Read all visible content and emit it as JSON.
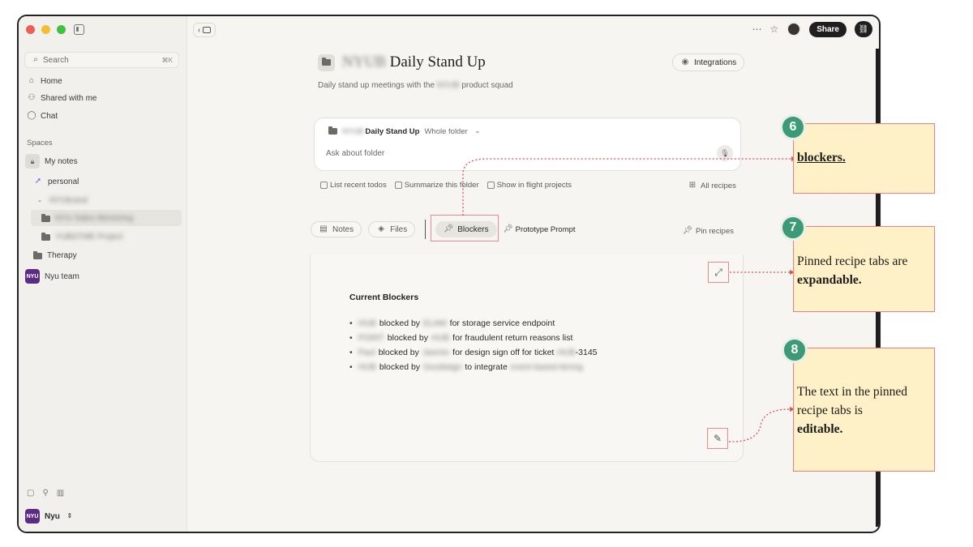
{
  "sidebar": {
    "search_placeholder": "Search",
    "search_shortcut": "⌘K",
    "nav": [
      {
        "label": "Home",
        "icon": "home-icon"
      },
      {
        "label": "Shared with me",
        "icon": "people-icon"
      },
      {
        "label": "Chat",
        "icon": "chat-icon"
      }
    ],
    "spaces_label": "Spaces",
    "my_notes": "My notes",
    "personal": "personal",
    "blurred_1": "NYUbrand",
    "blurred_2": "NYU Sales Mentoring",
    "blurred_3": "YUBOTME Project",
    "therapy": "Therapy",
    "team": "Nyu team",
    "team_badge": "NYU",
    "user": "Nyu",
    "user_badge": "NYU"
  },
  "header": {
    "back_label": "‹",
    "share_label": "Share",
    "title_prefix": "NYUB",
    "title": "Daily Stand Up",
    "integrations_label": "Integrations",
    "subtitle_pre": "Daily stand up meetings with the",
    "subtitle_blur": "NYUB",
    "subtitle_post": "product squad"
  },
  "ask": {
    "folder_blur": "NYUB",
    "folder_name": "Daily Stand Up",
    "scope": "Whole folder",
    "placeholder": "Ask about folder"
  },
  "recipes": {
    "items": [
      "List recent todos",
      "Summarize this folder",
      "Show in flight projects"
    ],
    "all_label": "All recipes"
  },
  "tabs": {
    "notes": "Notes",
    "files": "Files",
    "blockers": "Blockers",
    "prototype": "Prototype Prompt",
    "pin_label": "Pin recipes"
  },
  "content": {
    "title": "Current Blockers",
    "items": [
      {
        "who": "HUB",
        "mid": "blocked by",
        "by": "ELAM",
        "rest": "for storage service endpoint"
      },
      {
        "who": "POINT",
        "mid": "blocked by",
        "by": "HUB",
        "rest": "for fraudulent return reasons list"
      },
      {
        "who": "Paul",
        "mid": "blocked by",
        "by": "Jasmin",
        "rest": "for design sign off for ticket",
        "tail_blur": "HUB",
        "tail": "-3145"
      },
      {
        "who": "HUB",
        "mid": "blocked by",
        "by": "Goodwign",
        "rest": "to integrate",
        "tail_blur": "event based tiering"
      }
    ]
  },
  "callouts": [
    {
      "number": "6",
      "text_strong": "blockers."
    },
    {
      "number": "7",
      "text": "Pinned recipe tabs are",
      "text_strong": "expandable."
    },
    {
      "number": "8",
      "text": "The text in the pinned recipe tabs is",
      "text_strong": "editable."
    }
  ],
  "colors": {
    "badge_green": "#3c9a77",
    "note_fill": "#fff1c7",
    "note_border": "#ee7f7f",
    "connector": "#e0504f",
    "team_purple": "#5b2b86"
  }
}
